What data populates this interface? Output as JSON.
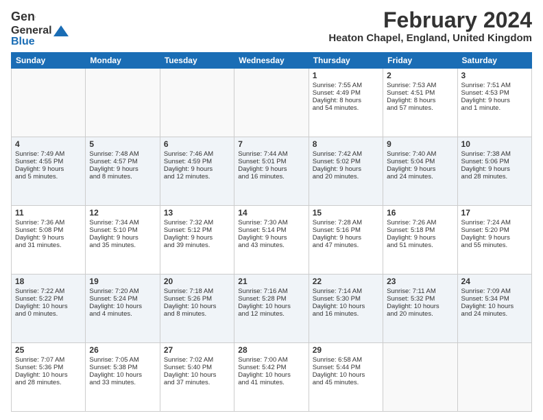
{
  "logo": {
    "general": "General",
    "blue": "Blue"
  },
  "title": "February 2024",
  "location": "Heaton Chapel, England, United Kingdom",
  "headers": [
    "Sunday",
    "Monday",
    "Tuesday",
    "Wednesday",
    "Thursday",
    "Friday",
    "Saturday"
  ],
  "weeks": [
    [
      {
        "day": "",
        "content": ""
      },
      {
        "day": "",
        "content": ""
      },
      {
        "day": "",
        "content": ""
      },
      {
        "day": "",
        "content": ""
      },
      {
        "day": "1",
        "content": "Sunrise: 7:55 AM\nSunset: 4:49 PM\nDaylight: 8 hours\nand 54 minutes."
      },
      {
        "day": "2",
        "content": "Sunrise: 7:53 AM\nSunset: 4:51 PM\nDaylight: 8 hours\nand 57 minutes."
      },
      {
        "day": "3",
        "content": "Sunrise: 7:51 AM\nSunset: 4:53 PM\nDaylight: 9 hours\nand 1 minute."
      }
    ],
    [
      {
        "day": "4",
        "content": "Sunrise: 7:49 AM\nSunset: 4:55 PM\nDaylight: 9 hours\nand 5 minutes."
      },
      {
        "day": "5",
        "content": "Sunrise: 7:48 AM\nSunset: 4:57 PM\nDaylight: 9 hours\nand 8 minutes."
      },
      {
        "day": "6",
        "content": "Sunrise: 7:46 AM\nSunset: 4:59 PM\nDaylight: 9 hours\nand 12 minutes."
      },
      {
        "day": "7",
        "content": "Sunrise: 7:44 AM\nSunset: 5:01 PM\nDaylight: 9 hours\nand 16 minutes."
      },
      {
        "day": "8",
        "content": "Sunrise: 7:42 AM\nSunset: 5:02 PM\nDaylight: 9 hours\nand 20 minutes."
      },
      {
        "day": "9",
        "content": "Sunrise: 7:40 AM\nSunset: 5:04 PM\nDaylight: 9 hours\nand 24 minutes."
      },
      {
        "day": "10",
        "content": "Sunrise: 7:38 AM\nSunset: 5:06 PM\nDaylight: 9 hours\nand 28 minutes."
      }
    ],
    [
      {
        "day": "11",
        "content": "Sunrise: 7:36 AM\nSunset: 5:08 PM\nDaylight: 9 hours\nand 31 minutes."
      },
      {
        "day": "12",
        "content": "Sunrise: 7:34 AM\nSunset: 5:10 PM\nDaylight: 9 hours\nand 35 minutes."
      },
      {
        "day": "13",
        "content": "Sunrise: 7:32 AM\nSunset: 5:12 PM\nDaylight: 9 hours\nand 39 minutes."
      },
      {
        "day": "14",
        "content": "Sunrise: 7:30 AM\nSunset: 5:14 PM\nDaylight: 9 hours\nand 43 minutes."
      },
      {
        "day": "15",
        "content": "Sunrise: 7:28 AM\nSunset: 5:16 PM\nDaylight: 9 hours\nand 47 minutes."
      },
      {
        "day": "16",
        "content": "Sunrise: 7:26 AM\nSunset: 5:18 PM\nDaylight: 9 hours\nand 51 minutes."
      },
      {
        "day": "17",
        "content": "Sunrise: 7:24 AM\nSunset: 5:20 PM\nDaylight: 9 hours\nand 55 minutes."
      }
    ],
    [
      {
        "day": "18",
        "content": "Sunrise: 7:22 AM\nSunset: 5:22 PM\nDaylight: 10 hours\nand 0 minutes."
      },
      {
        "day": "19",
        "content": "Sunrise: 7:20 AM\nSunset: 5:24 PM\nDaylight: 10 hours\nand 4 minutes."
      },
      {
        "day": "20",
        "content": "Sunrise: 7:18 AM\nSunset: 5:26 PM\nDaylight: 10 hours\nand 8 minutes."
      },
      {
        "day": "21",
        "content": "Sunrise: 7:16 AM\nSunset: 5:28 PM\nDaylight: 10 hours\nand 12 minutes."
      },
      {
        "day": "22",
        "content": "Sunrise: 7:14 AM\nSunset: 5:30 PM\nDaylight: 10 hours\nand 16 minutes."
      },
      {
        "day": "23",
        "content": "Sunrise: 7:11 AM\nSunset: 5:32 PM\nDaylight: 10 hours\nand 20 minutes."
      },
      {
        "day": "24",
        "content": "Sunrise: 7:09 AM\nSunset: 5:34 PM\nDaylight: 10 hours\nand 24 minutes."
      }
    ],
    [
      {
        "day": "25",
        "content": "Sunrise: 7:07 AM\nSunset: 5:36 PM\nDaylight: 10 hours\nand 28 minutes."
      },
      {
        "day": "26",
        "content": "Sunrise: 7:05 AM\nSunset: 5:38 PM\nDaylight: 10 hours\nand 33 minutes."
      },
      {
        "day": "27",
        "content": "Sunrise: 7:02 AM\nSunset: 5:40 PM\nDaylight: 10 hours\nand 37 minutes."
      },
      {
        "day": "28",
        "content": "Sunrise: 7:00 AM\nSunset: 5:42 PM\nDaylight: 10 hours\nand 41 minutes."
      },
      {
        "day": "29",
        "content": "Sunrise: 6:58 AM\nSunset: 5:44 PM\nDaylight: 10 hours\nand 45 minutes."
      },
      {
        "day": "",
        "content": ""
      },
      {
        "day": "",
        "content": ""
      }
    ]
  ]
}
